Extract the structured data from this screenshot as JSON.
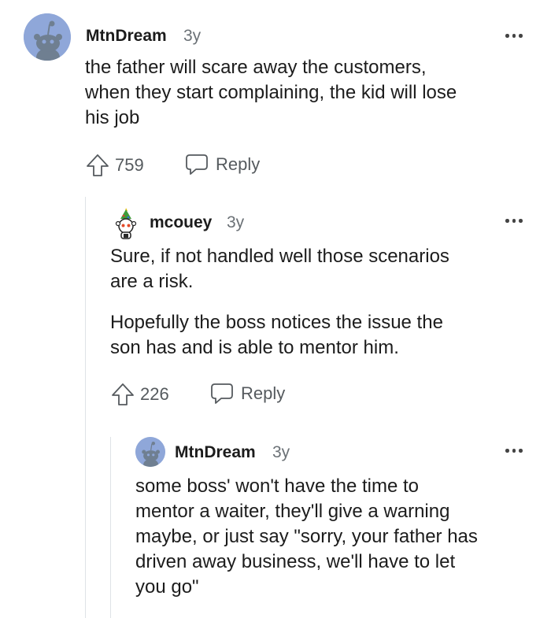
{
  "comments": [
    {
      "author": "MtnDream",
      "age": "3y",
      "body_lines": [
        "the father will scare away the customers,",
        "when they start complaining, the kid will lose",
        "his job"
      ],
      "upvotes": "759",
      "reply_label": "Reply",
      "avatar_icon": "snoo-avatar-icon",
      "avatar_color": "#8fa7d9"
    },
    {
      "author": "mcouey",
      "age": "3y",
      "paragraphs": [
        [
          "Sure, if not handled well those scenarios",
          "are a risk."
        ],
        [
          "Hopefully the boss notices the issue the",
          "son has and is able to mentor him."
        ]
      ],
      "upvotes": "226",
      "reply_label": "Reply",
      "avatar_icon": "snoo-christmas-avatar-icon"
    },
    {
      "author": "MtnDream",
      "age": "3y",
      "body_lines": [
        "some boss' won't have the time to",
        "mentor a waiter, they'll give a warning",
        "maybe, or just say \"sorry, your father has",
        "driven away business, we'll have to let",
        "you go\""
      ],
      "avatar_icon": "snoo-avatar-icon",
      "avatar_color": "#8fa7d9"
    }
  ]
}
